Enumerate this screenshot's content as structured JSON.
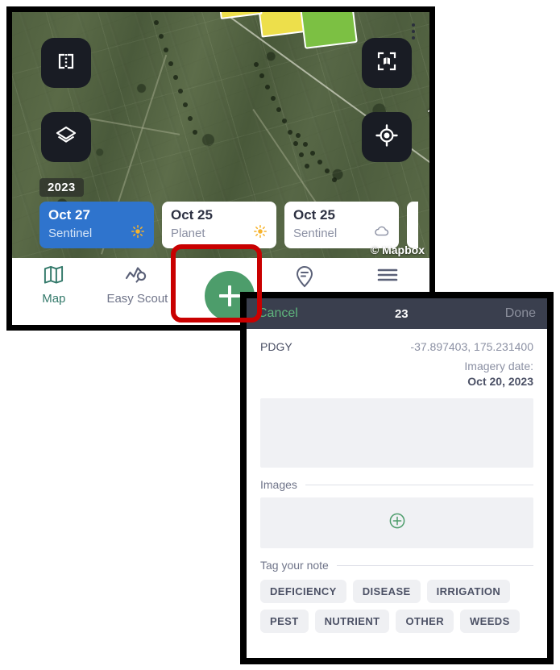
{
  "map_screen": {
    "controls": [
      {
        "name": "compare-split-button",
        "icon": "compare-split-icon"
      },
      {
        "name": "layers-button",
        "icon": "layers-icon"
      },
      {
        "name": "fit-map-button",
        "icon": "fit-map-icon"
      },
      {
        "name": "locate-me-button",
        "icon": "locate-crosshair-icon"
      }
    ],
    "year_badge": "2023",
    "road_label": "N",
    "attribution": "© Mapbox",
    "imagery_dates": [
      {
        "day": "Oct 27",
        "source": "Sentinel",
        "weather": "sunny",
        "selected": true
      },
      {
        "day": "Oct 25",
        "source": "Planet",
        "weather": "sunny",
        "selected": false
      },
      {
        "day": "Oct 25",
        "source": "Sentinel",
        "weather": "cloudy",
        "selected": false
      }
    ],
    "more_dates_label": "more-imagery-dates",
    "tabs": [
      {
        "label": "Map",
        "icon": "map-icon",
        "active": true
      },
      {
        "label": "Easy Scout",
        "icon": "scout-chart-icon",
        "active": false
      },
      {
        "label": "",
        "icon": "note-pin-icon",
        "active": false
      },
      {
        "label": "",
        "icon": "hamburger-menu-icon",
        "active": false
      }
    ],
    "fab": {
      "label": "+",
      "name": "add-note-button"
    },
    "annotation": {
      "shape": "rounded-rect",
      "color": "#c90000",
      "target": "add-note-button"
    }
  },
  "note_sheet": {
    "cancel_label": "Cancel",
    "title": "23",
    "done_label": "Done",
    "field_name": "PDGY",
    "coordinates": "-37.897403, 175.231400",
    "imagery_date_label": "Imagery date:",
    "imagery_date_value": "Oct 20, 2023",
    "note_text": "",
    "note_placeholder": "",
    "images_section_label": "Images",
    "add_image_icon": "plus-circle-icon",
    "tags_section_label": "Tag your note",
    "tags": [
      "DEFICIENCY",
      "DISEASE",
      "IRRIGATION",
      "PEST",
      "NUTRIENT",
      "OTHER",
      "WEEDS"
    ]
  },
  "colors": {
    "selected_date_blue": "#2f74cd",
    "fab_green": "#4d9d6b",
    "cancel_green": "#5fb57d",
    "header_slate": "#3a3f4e",
    "active_tab_teal": "#33796a",
    "annotation_red": "#c90000"
  }
}
